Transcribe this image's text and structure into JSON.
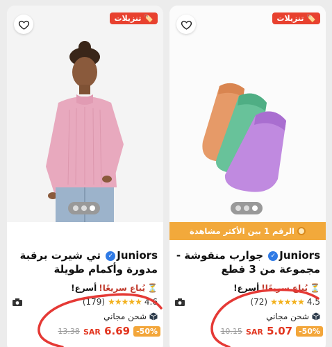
{
  "cards": [
    {
      "sale_badge": "🏷️ تنزيلات",
      "brand": "Juniors",
      "title_text": "تي شيرت برقبة مدورة وأكمام طويلة",
      "sell_fast_prefix": "⏳",
      "sell_fast": "يُباع سريعًا!",
      "sell_fast_suffix": "أسرع!",
      "rating": "4.6",
      "stars": "★★★★★",
      "reviews": "(179)",
      "shipping": "شحن مجاني",
      "discount": "-50%",
      "price": "6.69",
      "currency": "SAR",
      "old_price": "13.38"
    },
    {
      "sale_badge": "🏷️ تنزيلات",
      "rank_banner": "الرقم 1 بين الأكثر مشاهدة",
      "brand": "Juniors",
      "title_text": "جوارب منقوشة - مجموعة من 3 قطع",
      "sell_fast_prefix": "⏳",
      "sell_fast": "يُباع سريعًا!",
      "sell_fast_suffix": "أسرع!",
      "rating": "4.5",
      "stars": "★★★★★",
      "reviews": "(72)",
      "shipping": "شحن مجاني",
      "discount": "-50%",
      "price": "5.07",
      "currency": "SAR",
      "old_price": "10.15"
    }
  ],
  "colors": {
    "sale_badge": "#e8412f",
    "price": "#e2351f",
    "discount": "#f3a63a",
    "rank_banner": "#f2a93b",
    "annotation": "#e53935"
  },
  "icons": [
    "heart-icon",
    "verified-icon",
    "hourglass-icon",
    "camera-icon",
    "box-icon",
    "medal-icon"
  ]
}
